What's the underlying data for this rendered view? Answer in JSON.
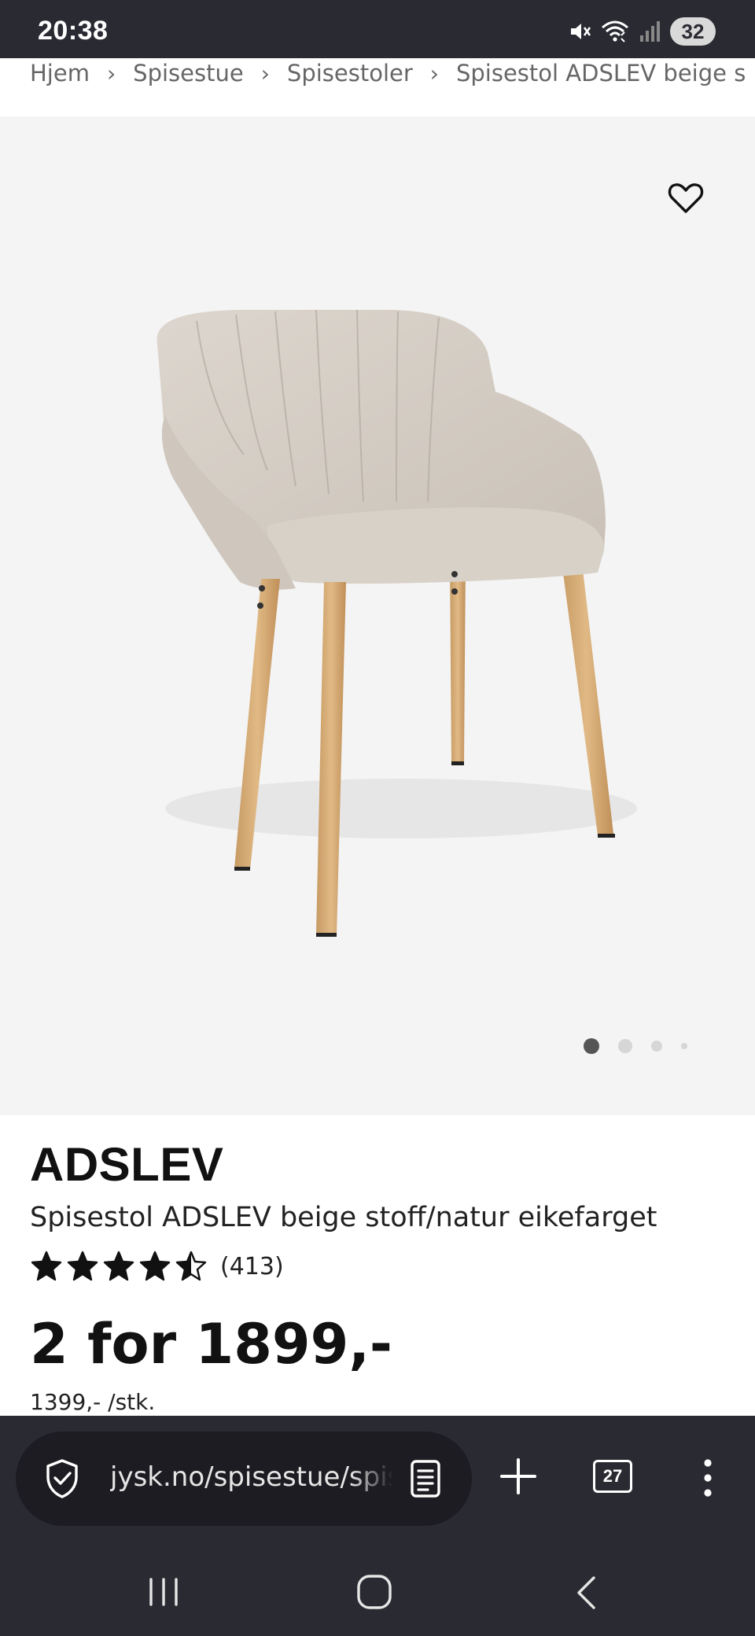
{
  "status_bar": {
    "time": "20:38",
    "battery": "32",
    "icons": [
      "mute-icon",
      "wifi-icon",
      "signal-icon",
      "battery-icon"
    ]
  },
  "breadcrumb": {
    "items": [
      "Hjem",
      "Spisestue",
      "Spisestoler",
      "Spisestol ADSLEV beige s"
    ],
    "separator": "›"
  },
  "gallery": {
    "image": "chair-photo",
    "wishlist_icon": "heart-icon",
    "dot_count": 4,
    "active_dot": 0
  },
  "product": {
    "brand": "ADSLEV",
    "name": "Spisestol ADSLEV beige stoff/natur eikefarget",
    "rating": 4.5,
    "rating_max": 5,
    "review_count": "(413)",
    "price": "2 for 1899,-",
    "unit_price": "1399,- /stk."
  },
  "browser": {
    "url": "jysk.no/spisestue/spisestoler",
    "tab_count": "27",
    "icons": [
      "shield-check-icon",
      "reader-mode-icon",
      "new-tab-icon",
      "tabs-icon",
      "more-menu-icon"
    ]
  },
  "nav": {
    "icons": [
      "recent-apps-icon",
      "home-icon",
      "back-icon"
    ]
  },
  "colors": {
    "status_bar_bg": "#2a2a33",
    "gallery_bg": "#f4f4f4",
    "text": "#111111",
    "breadcrumb_text": "#666666"
  }
}
